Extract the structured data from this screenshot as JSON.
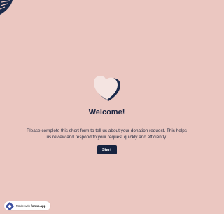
{
  "welcome": {
    "title": "Welcome!",
    "description": "Please complete this short form to tell us about your donation request. This helps us review and respond to your request quickly and efficiently.",
    "start_label": "Start"
  },
  "badge": {
    "prefix": "Made with",
    "brand": "forms.app"
  },
  "colors": {
    "background": "#EBC7C1",
    "accent": "#17233F",
    "heart_fill": "#F4E4E1"
  }
}
